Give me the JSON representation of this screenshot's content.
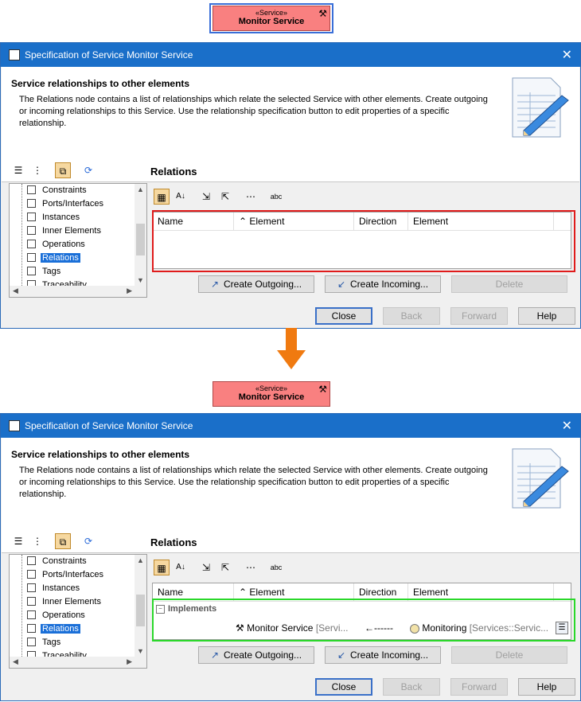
{
  "service_symbol": {
    "stereotype": "«Service»",
    "name": "Monitor Service",
    "icon": "tools-icon",
    "fill_color": "#f98080"
  },
  "dialog": {
    "title": "Specification of Service Monitor Service",
    "close_glyph": "✕",
    "header_title": "Service relationships to other elements",
    "header_description": "The Relations node contains a list of relationships which relate the selected Service with other elements. Create outgoing or incoming relationships to this Service. Use the relationship specification button to edit properties of a specific relationship.",
    "tree_items": [
      "Constraints",
      "Ports/Interfaces",
      "Instances",
      "Inner Elements",
      "Operations",
      "Relations",
      "Tags",
      "Traceability"
    ],
    "selected_tree_item": "Relations",
    "pane_title": "Relations",
    "columns": [
      "Name",
      "Element",
      "Direction",
      "Element"
    ],
    "create_outgoing_label": "Create Outgoing...",
    "create_incoming_label": "Create Incoming...",
    "delete_label": "Delete",
    "close_label": "Close",
    "back_label": "Back",
    "forward_label": "Forward",
    "help_label": "Help"
  },
  "after_relation": {
    "group_label": "Implements",
    "source_element": "Monitor Service",
    "source_qualifier": "[Servi...",
    "direction": "←------",
    "target_element": "Monitoring",
    "target_qualifier": "[Services::Servic..."
  },
  "colors": {
    "title_bar": "#1a6fc9",
    "before_highlight": "#e01b1b",
    "after_highlight": "#2ad82a",
    "transition_arrow": "#f07a10",
    "selection": "#1a6fd8"
  }
}
